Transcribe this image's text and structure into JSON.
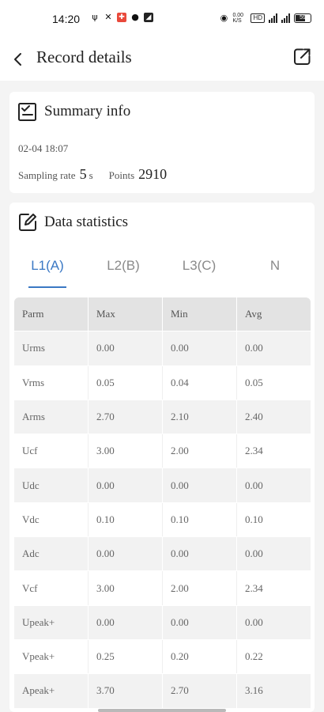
{
  "status_bar": {
    "time": "14:20",
    "left_icons": [
      "usb-icon",
      "tool-icon",
      "app-red-icon",
      "soccer-icon",
      "app-dark-icon"
    ],
    "right_icons": [
      "alarm-icon",
      "net-speed-icon",
      "volte-icon",
      "signal-1-icon",
      "signal-2-icon",
      "battery-icon"
    ],
    "net_speed": "0.00 K/S",
    "volte": "HD",
    "battery": "59"
  },
  "header": {
    "title": "Record details"
  },
  "summary": {
    "title": "Summary info",
    "datetime": "02-04 18:07",
    "sampling_label": "Sampling rate",
    "sampling_value": "5",
    "sampling_unit": "s",
    "points_label": "Points",
    "points_value": "2910"
  },
  "stats": {
    "title": "Data statistics",
    "tabs": [
      {
        "label": "L1(A)",
        "active": true
      },
      {
        "label": "L2(B)",
        "active": false
      },
      {
        "label": "L3(C)",
        "active": false
      },
      {
        "label": "N",
        "active": false
      }
    ],
    "columns": [
      "Parm",
      "Max",
      "Min",
      "Avg"
    ],
    "rows": [
      [
        "Urms",
        "0.00",
        "0.00",
        "0.00"
      ],
      [
        "Vrms",
        "0.05",
        "0.04",
        "0.05"
      ],
      [
        "Arms",
        "2.70",
        "2.10",
        "2.40"
      ],
      [
        "Ucf",
        "3.00",
        "2.00",
        "2.34"
      ],
      [
        "Udc",
        "0.00",
        "0.00",
        "0.00"
      ],
      [
        "Vdc",
        "0.10",
        "0.10",
        "0.10"
      ],
      [
        "Adc",
        "0.00",
        "0.00",
        "0.00"
      ],
      [
        "Vcf",
        "3.00",
        "2.00",
        "2.34"
      ],
      [
        "Upeak+",
        "0.00",
        "0.00",
        "0.00"
      ],
      [
        "Vpeak+",
        "0.25",
        "0.20",
        "0.22"
      ],
      [
        "Apeak+",
        "3.70",
        "2.70",
        "3.16"
      ]
    ]
  },
  "colors": {
    "accent": "#3a78c4",
    "background": "#f4f4f4",
    "table_header": "#e3e3e3"
  }
}
